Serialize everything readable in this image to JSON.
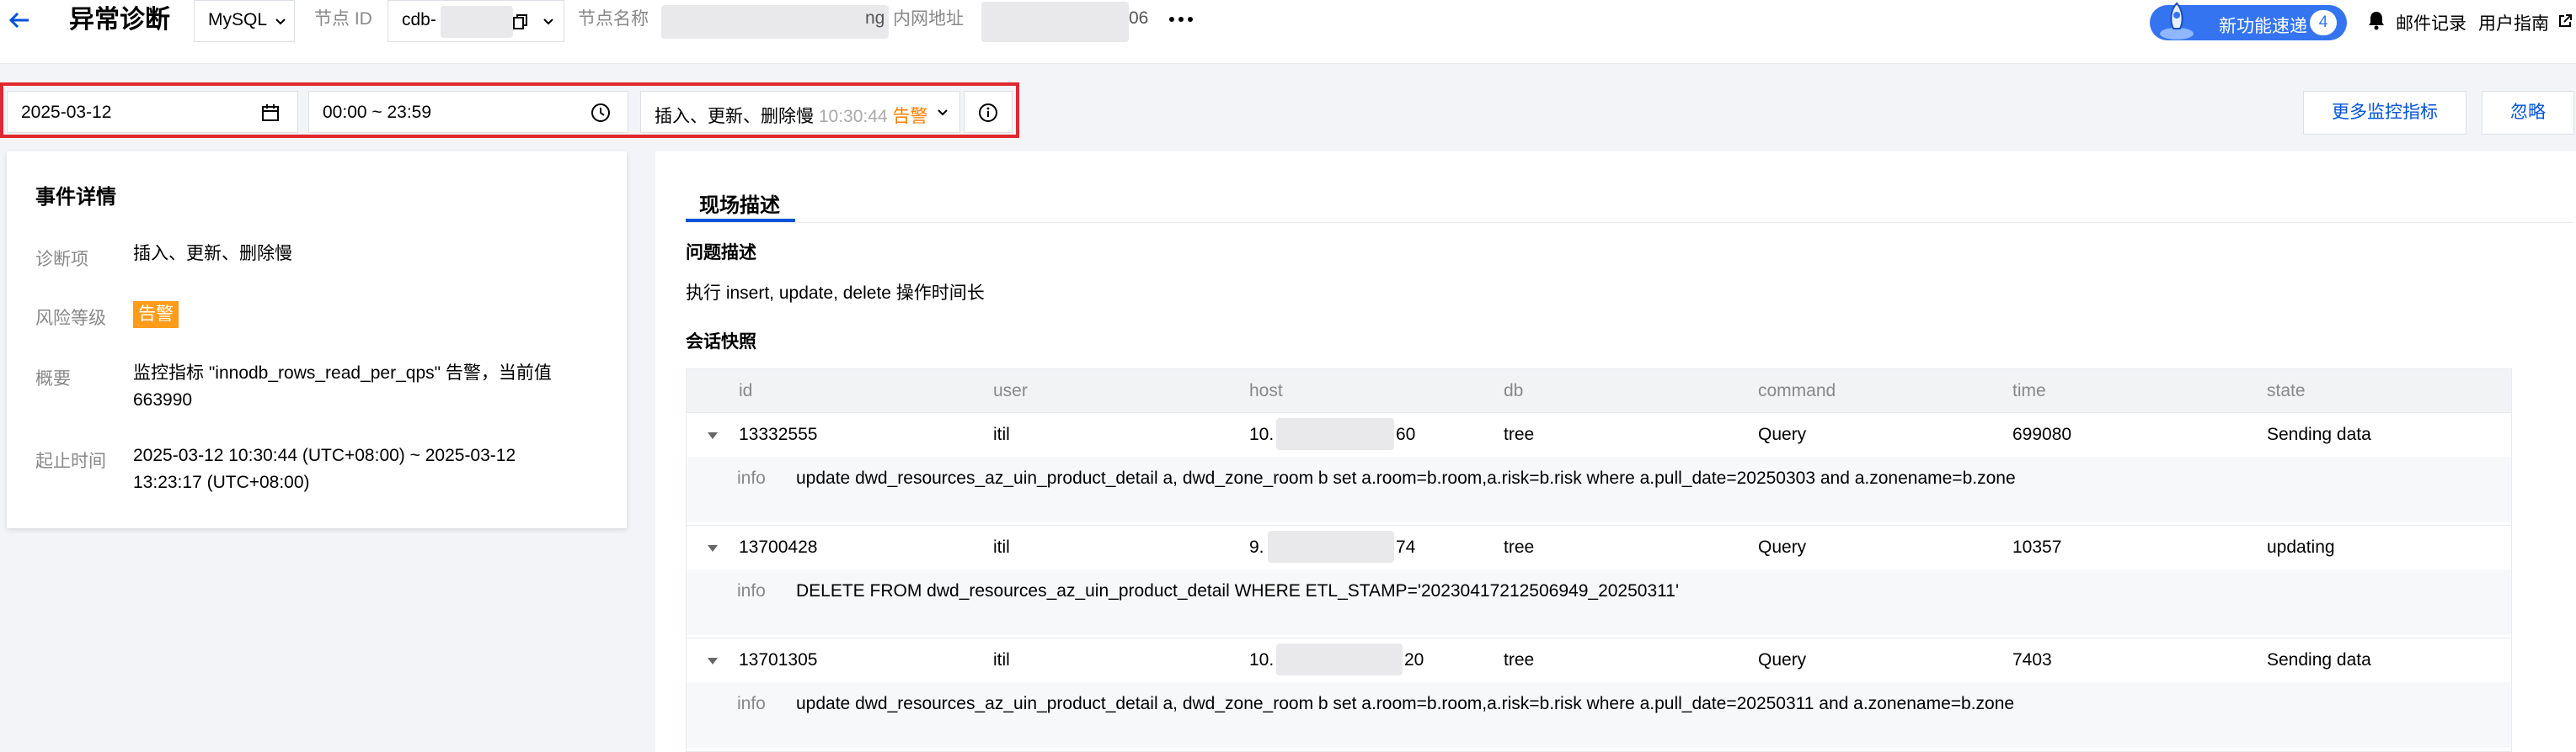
{
  "header": {
    "title": "异常诊断",
    "db_type": "MySQL",
    "node_id_label": "节点 ID",
    "node_id_value": "cdb-",
    "node_name_label": "节点名称",
    "node_name_suffix": "ng",
    "intranet_label": "内网地址",
    "intranet_suffix": "06",
    "new_feature_label": "新功能速递",
    "new_feature_count": "4",
    "mail_record": "邮件记录",
    "user_guide": "用户指南"
  },
  "filters": {
    "date": "2025-03-12",
    "time_range": "00:00 ~ 23:59",
    "metric_name": "插入、更新、删除慢",
    "metric_time": "10:30:44",
    "metric_level": "告警",
    "more_metrics_button": "更多监控指标",
    "ignore_button": "忽略"
  },
  "event_details": {
    "title": "事件详情",
    "diagnosis_label": "诊断项",
    "diagnosis_value": "插入、更新、删除慢",
    "risk_label": "风险等级",
    "risk_value": "告警",
    "summary_label": "概要",
    "summary_value": "监控指标 \"innodb_rows_read_per_qps\" 告警，当前值 663990",
    "time_label": "起止时间",
    "time_value": "2025-03-12 10:30:44 (UTC+08:00) ~ 2025-03-12 13:23:17 (UTC+08:00)"
  },
  "scene": {
    "tab_label": "现场描述",
    "problem_heading": "问题描述",
    "problem_text": "执行 insert, update, delete 操作时间长",
    "snapshot_heading": "会话快照",
    "columns": [
      "id",
      "user",
      "host",
      "db",
      "command",
      "time",
      "state"
    ],
    "info_label": "info",
    "rows": [
      {
        "id": "13332555",
        "user": "itil",
        "host_prefix": "10.",
        "host_suffix": "60",
        "db": "tree",
        "command": "Query",
        "time": "699080",
        "state": "Sending data",
        "info": "update dwd_resources_az_uin_product_detail a, dwd_zone_room b set a.room=b.room,a.risk=b.risk where a.pull_date=20250303 and a.zonename=b.zone"
      },
      {
        "id": "13700428",
        "user": "itil",
        "host_prefix": "9.",
        "host_suffix": "74",
        "db": "tree",
        "command": "Query",
        "time": "10357",
        "state": "updating",
        "info": "DELETE FROM dwd_resources_az_uin_product_detail WHERE ETL_STAMP='20230417212506949_20250311'"
      },
      {
        "id": "13701305",
        "user": "itil",
        "host_prefix": "10.",
        "host_suffix": "20",
        "db": "tree",
        "command": "Query",
        "time": "7403",
        "state": "Sending data",
        "info": "update dwd_resources_az_uin_product_detail a, dwd_zone_room b set a.room=b.room,a.risk=b.risk where a.pull_date=20250311 and a.zonename=b.zone"
      }
    ]
  }
}
